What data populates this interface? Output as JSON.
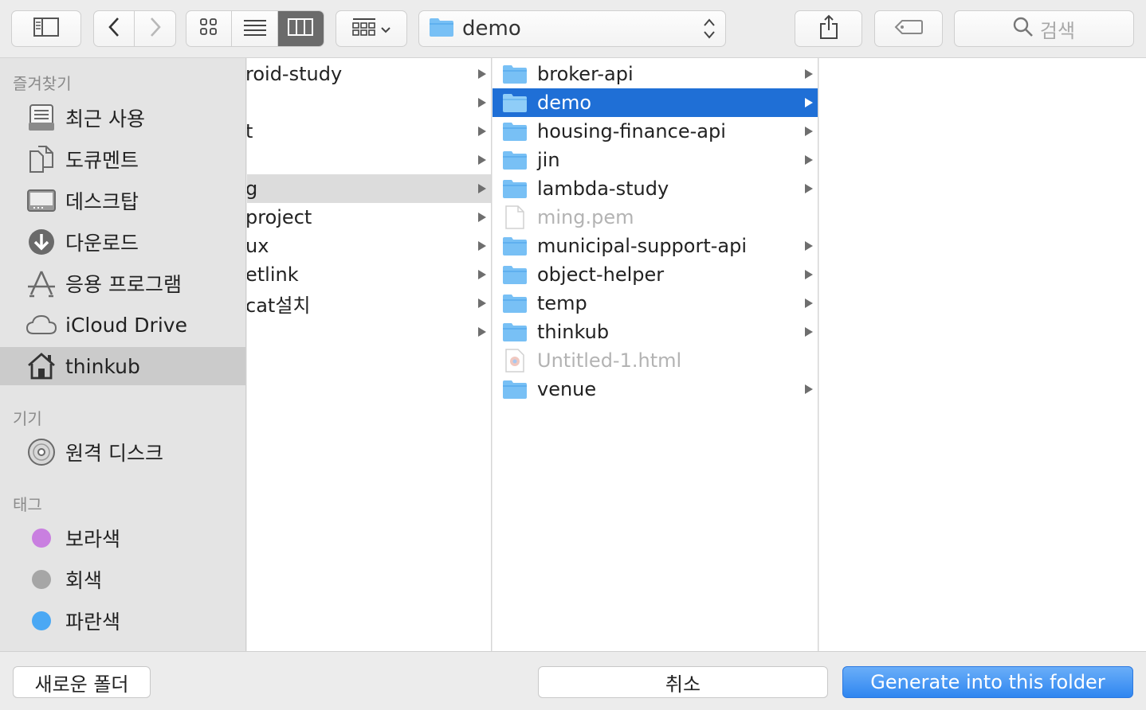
{
  "toolbar": {
    "path_label": "demo",
    "search_placeholder": "검색",
    "icons": [
      "sidebar-toggle-icon",
      "back-icon",
      "forward-icon",
      "icon-view-icon",
      "list-view-icon",
      "column-view-icon",
      "group-icon",
      "chevron-down-icon",
      "folder-icon",
      "updown-icon",
      "share-icon",
      "tag-icon",
      "search-icon"
    ]
  },
  "sidebar": {
    "favorites_header": "즐겨찾기",
    "favorites": [
      {
        "label": "최근 사용",
        "icon": "recents-icon"
      },
      {
        "label": "도큐멘트",
        "icon": "documents-icon"
      },
      {
        "label": "데스크탑",
        "icon": "desktop-icon"
      },
      {
        "label": "다운로드",
        "icon": "downloads-icon"
      },
      {
        "label": "응용 프로그램",
        "icon": "applications-icon"
      },
      {
        "label": "iCloud Drive",
        "icon": "cloud-icon"
      },
      {
        "label": "thinkub",
        "icon": "home-icon",
        "selected": true
      }
    ],
    "devices_header": "기기",
    "devices": [
      {
        "label": "원격 디스크",
        "icon": "disc-icon"
      }
    ],
    "tags_header": "태그",
    "tags": [
      {
        "label": "보라색",
        "color": "#c97fe0"
      },
      {
        "label": "회색",
        "color": "#a6a6a6"
      },
      {
        "label": "파란색",
        "color": "#4aa8f4"
      }
    ]
  },
  "column1": {
    "items": [
      {
        "name": "roid-study"
      },
      {
        "name": ""
      },
      {
        "name": "t"
      },
      {
        "name": ""
      },
      {
        "name": "g",
        "selected": true
      },
      {
        "name": "project"
      },
      {
        "name": "ux"
      },
      {
        "name": "etlink"
      },
      {
        "name": "cat설치"
      },
      {
        "name": ""
      }
    ]
  },
  "column2": {
    "items": [
      {
        "name": "broker-api",
        "type": "folder"
      },
      {
        "name": "demo",
        "type": "folder",
        "selected": true
      },
      {
        "name": "housing-finance-api",
        "type": "folder"
      },
      {
        "name": "jin",
        "type": "folder"
      },
      {
        "name": "lambda-study",
        "type": "folder"
      },
      {
        "name": "ming.pem",
        "type": "file",
        "disabled": true
      },
      {
        "name": "municipal-support-api",
        "type": "folder"
      },
      {
        "name": "object-helper",
        "type": "folder"
      },
      {
        "name": "temp",
        "type": "folder"
      },
      {
        "name": "thinkub",
        "type": "folder"
      },
      {
        "name": "Untitled-1.html",
        "type": "html",
        "disabled": true
      },
      {
        "name": "venue",
        "type": "folder"
      }
    ]
  },
  "footer": {
    "new_folder_label": "새로운 폴더",
    "cancel_label": "취소",
    "primary_label": "Generate into this folder"
  },
  "colors": {
    "selection": "#1f6fd6",
    "folder": "#78c0f5",
    "primary_button": "#3a8ef3"
  }
}
